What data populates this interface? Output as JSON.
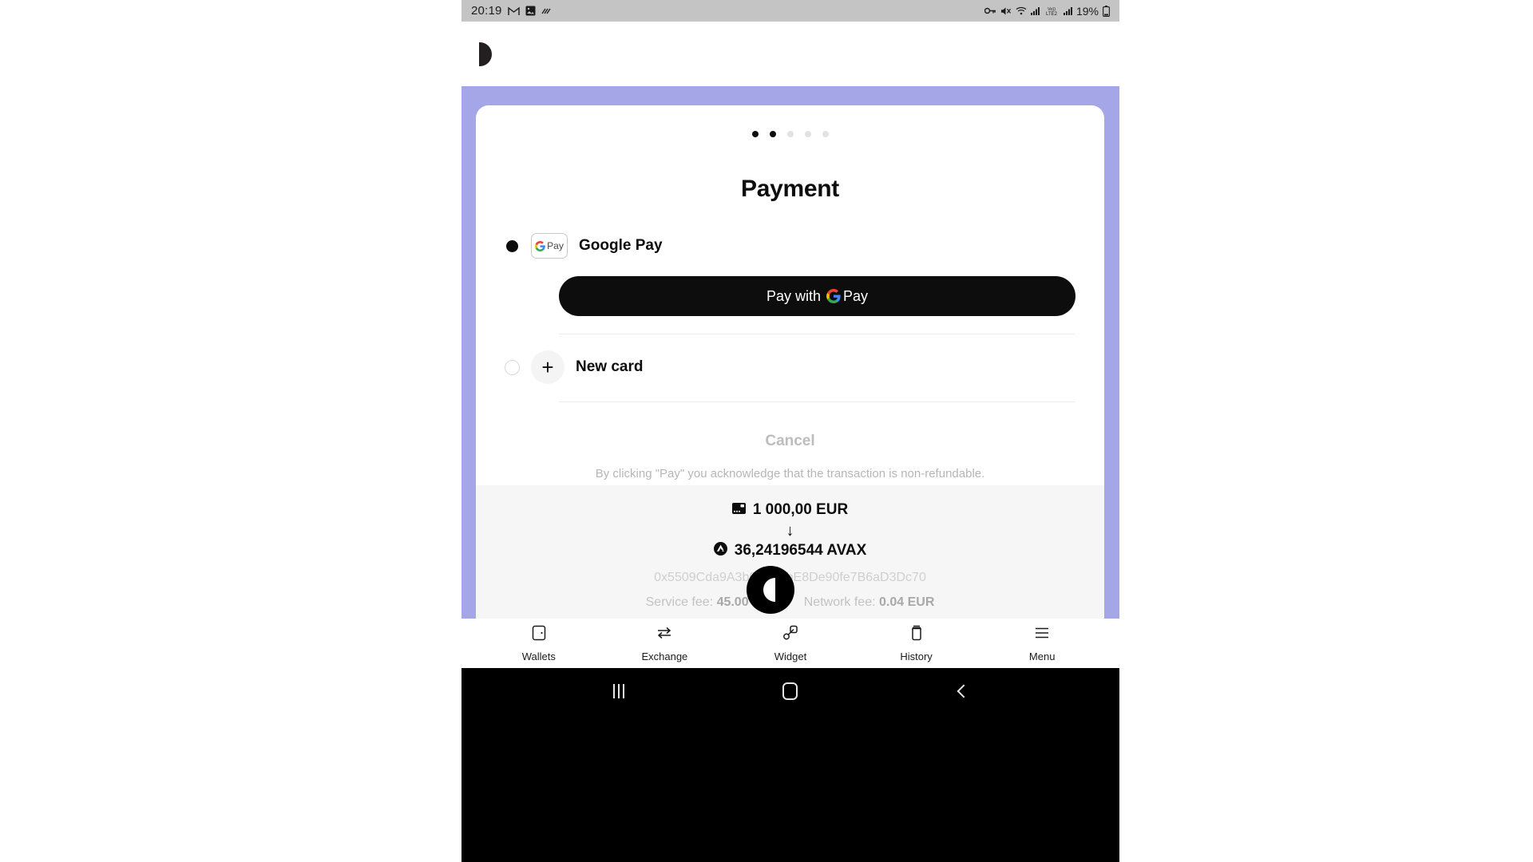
{
  "status_bar": {
    "time": "20:19",
    "left_icons": [
      "gmail-icon",
      "photo-icon",
      "motion-icon"
    ],
    "right_icons": [
      "key-icon",
      "mute-icon",
      "wifi-icon",
      "signal-icon",
      "volte2-icon",
      "signal2-icon"
    ],
    "battery_percent": "19%"
  },
  "app_bar": {
    "logo": "half-circle-logo"
  },
  "card": {
    "dots_total": 5,
    "dots_active": 2,
    "title": "Payment",
    "methods": [
      {
        "id": "google-pay",
        "label": "Google Pay",
        "selected": true,
        "badge_g": "G",
        "badge_pay": "Pay",
        "button_label": "Pay with",
        "button_g": "G",
        "button_pay": "Pay"
      },
      {
        "id": "new-card",
        "label": "New card",
        "selected": false,
        "plus": "+"
      }
    ],
    "cancel_label": "Cancel",
    "disclaimer": "By clicking \"Pay\" you acknowledge that the transaction is non-refundable."
  },
  "summary": {
    "fiat_amount": "1 000,00 EUR",
    "fiat_icon": "card-icon",
    "arrow": "↓",
    "crypto_amount": "36,24196544 AVAX",
    "crypto_icon": "avax-icon",
    "wallet_address": "0x5509Cda9A3b07aAabE8De90fe7B6aD3Dc70",
    "service_fee_label": "Service fee:",
    "service_fee_value": "45.00 EUR",
    "network_fee_label": "Network fee:",
    "network_fee_value": "0.04 EUR"
  },
  "fab": {
    "name": "contrast-toggle"
  },
  "bottom_nav": [
    {
      "label": "Wallets",
      "icon": "wallet-icon"
    },
    {
      "label": "Exchange",
      "icon": "exchange-icon"
    },
    {
      "label": "Widget",
      "icon": "widget-icon"
    },
    {
      "label": "History",
      "icon": "history-icon"
    },
    {
      "label": "Menu",
      "icon": "menu-icon"
    }
  ],
  "system_nav": {
    "recents": "recents-button",
    "home": "home-button",
    "back": "back-button"
  },
  "colors": {
    "accent_purple": "#a5a6e8",
    "button_black": "#0d0d0d",
    "summary_bg": "#f6f6f6"
  }
}
